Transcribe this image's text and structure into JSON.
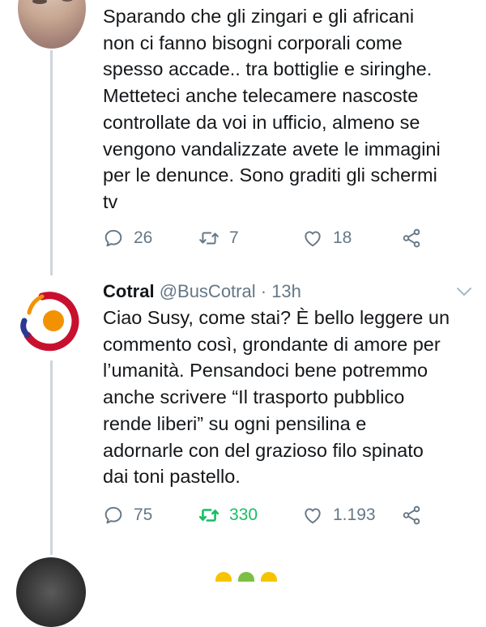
{
  "tweet1": {
    "lines": [
      "Sparando che gli zingari e gli africani",
      "non ci fanno bisogni corporali come",
      "spesso accade.. tra bottiglie e siringhe.",
      "Metteteci anche telecamere nascoste",
      "controllate da voi in ufficio, almeno se",
      "vengono vandalizzate avete le immagini",
      "per le denunce. Sono graditi gli schermi",
      "tv"
    ],
    "actions": {
      "replies": "26",
      "retweets": "7",
      "likes": "18"
    }
  },
  "tweet2": {
    "author_name": "Cotral",
    "author_handle": "@BusCotral",
    "separator": " · ",
    "time": "13h",
    "lines": [
      "Ciao Susy, come stai? È bello leggere un",
      "commento così, grondante di amore per",
      "l’umanità. Pensandoci bene potremmo",
      "anche scrivere “Il trasporto pubblico",
      "rende liberi” su ogni pensilina e",
      "adornarle con del grazioso filo spinato",
      "dai toni pastello."
    ],
    "actions": {
      "replies": "75",
      "retweets": "330",
      "likes": "1.193"
    }
  },
  "colors": {
    "text": "#14171a",
    "secondary": "#657786",
    "retweet_active": "#17bf63",
    "thread_line": "#ccd6dd",
    "cotral_red": "#c8102e",
    "cotral_orange": "#f39200",
    "cotral_blue": "#2b3990"
  },
  "icons": [
    "reply-icon",
    "retweet-icon",
    "like-icon",
    "share-icon",
    "chevron-down-icon"
  ]
}
